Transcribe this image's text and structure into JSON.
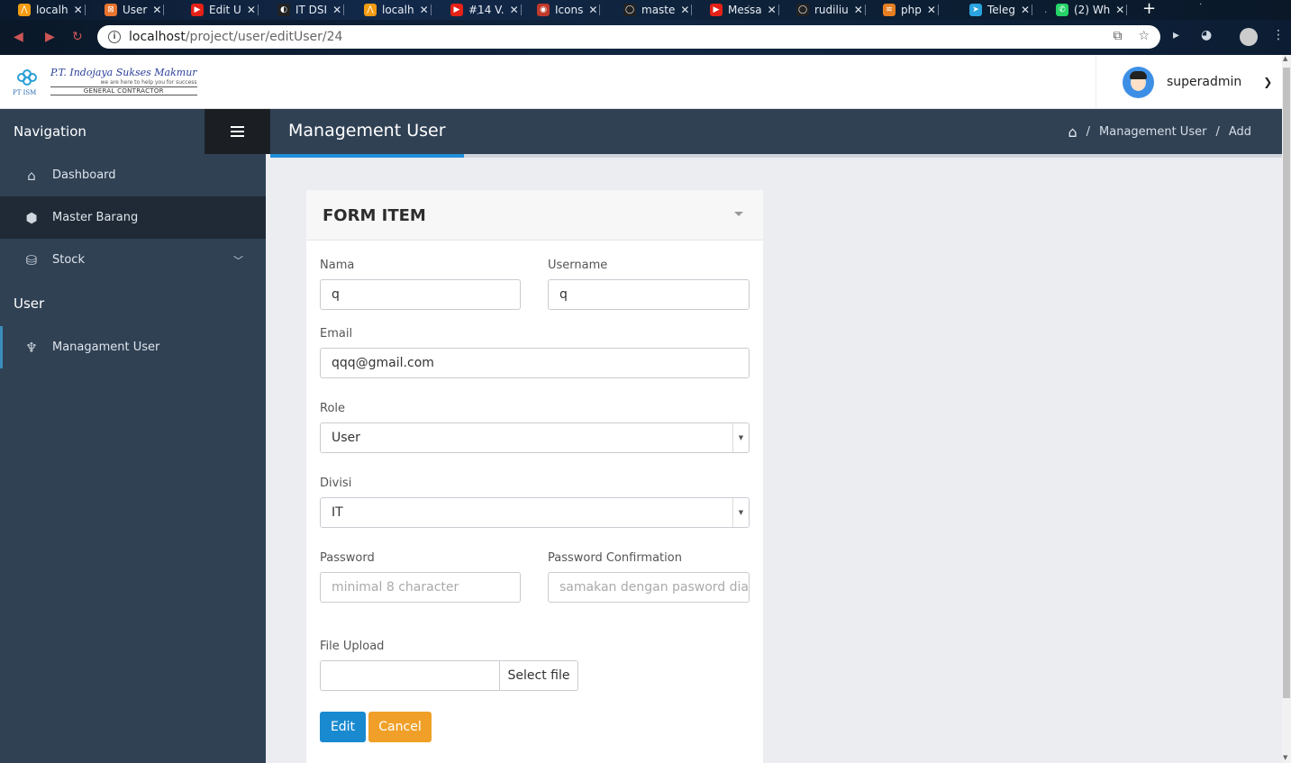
{
  "browser": {
    "tabs": [
      {
        "title": "localh",
        "fav_color": "#f39c12",
        "fav": "⋀"
      },
      {
        "title": "User",
        "fav_color": "#e8742e",
        "fav": "⊠"
      },
      {
        "title": "Edit U",
        "fav_color": "#e62117",
        "fav": "▶"
      },
      {
        "title": "IT DSI",
        "fav_color": "#222222",
        "fav": "◐"
      },
      {
        "title": "localh",
        "fav_color": "#f39c12",
        "fav": "⋀"
      },
      {
        "title": "#14 V.",
        "fav_color": "#e62117",
        "fav": "▶"
      },
      {
        "title": "Icons",
        "fav_color": "#c0392b",
        "fav": "◉"
      },
      {
        "title": "maste",
        "fav_color": "#222222",
        "fav": "◯"
      },
      {
        "title": "Messa",
        "fav_color": "#e62117",
        "fav": "▶"
      },
      {
        "title": "rudiliu",
        "fav_color": "#222222",
        "fav": "◯"
      },
      {
        "title": "php",
        "fav_color": "#e67e22",
        "fav": "≋"
      },
      {
        "title": "Teleg",
        "fav_color": "#2aa3de",
        "fav": "➤"
      },
      {
        "title": "(2) Wh",
        "fav_color": "#25d366",
        "fav": "✆"
      }
    ],
    "url_host": "localhost",
    "url_path": "/project/user/editUser/24"
  },
  "header": {
    "company": "P.T. Indojaya Sukses Makmur",
    "tagline": "we are here to help you for success",
    "contractor": "GENERAL CONTRACTOR",
    "logo_abbrev": "PT ISM",
    "username": "superadmin"
  },
  "sidebar": {
    "nav_title": "Navigation",
    "items": [
      {
        "label": "Dashboard",
        "icon": "⌂"
      },
      {
        "label": "Master Barang",
        "icon": "⬢"
      },
      {
        "label": "Stock",
        "icon": "⛁"
      }
    ],
    "group_user": "User",
    "user_items": [
      {
        "label": "Managament User",
        "icon": "♆"
      }
    ]
  },
  "page": {
    "title": "Management User",
    "breadcrumb": [
      "Management User",
      "Add"
    ],
    "breadcrumb_sep": "/"
  },
  "form": {
    "title": "FORM ITEM",
    "nama_label": "Nama",
    "nama_value": "q",
    "username_label": "Username",
    "username_value": "q",
    "email_label": "Email",
    "email_value": "qqq@gmail.com",
    "role_label": "Role",
    "role_value": "User",
    "divisi_label": "Divisi",
    "divisi_value": "IT",
    "password_label": "Password",
    "password_placeholder": "minimal 8 character",
    "password_conf_label": "Password Confirmation",
    "password_conf_placeholder": "samakan dengan pasword diat",
    "file_label": "File Upload",
    "file_button": "Select file",
    "edit_button": "Edit",
    "cancel_button": "Cancel"
  },
  "colors": {
    "sidebar": "#304154",
    "accent": "#1f8fd8",
    "edit_btn": "#1a8ad0",
    "cancel_btn": "#f0a028"
  }
}
